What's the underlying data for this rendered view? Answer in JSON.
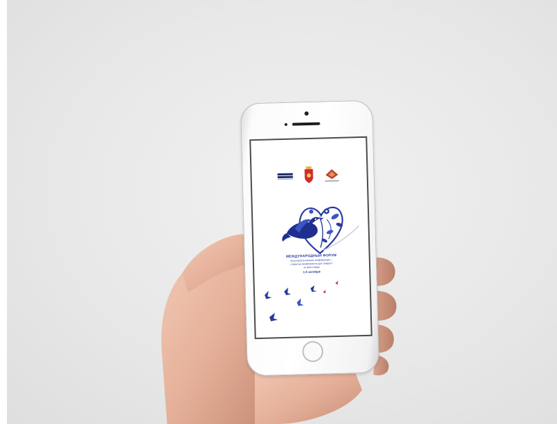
{
  "scene": {
    "background_color": "#e9e9e9",
    "skin_color": "#e9b7a0"
  },
  "phone": {
    "body_color": "#ffffff",
    "screen_border_color": "#4b4b4b"
  },
  "screen": {
    "accent_color": "#2a3b9e",
    "logos": [
      {
        "name": "museum-logo",
        "text": "МУЗЕЙ"
      },
      {
        "name": "regional-crest",
        "text": ""
      },
      {
        "name": "diamond-logo",
        "text": ""
      }
    ],
    "forum": {
      "title": "МЕЖДУНАРОДНЫЙ ФОРУМ",
      "subtitle_line1": "Культурологические конференции –",
      "subtitle_line2": "открытые возможности для каждого",
      "subtitle_line3": "из всего мира",
      "date": "1-5 октября"
    }
  },
  "icons": {
    "hero": "folk-bird-heart-illustration",
    "decor": "flying-birds"
  }
}
